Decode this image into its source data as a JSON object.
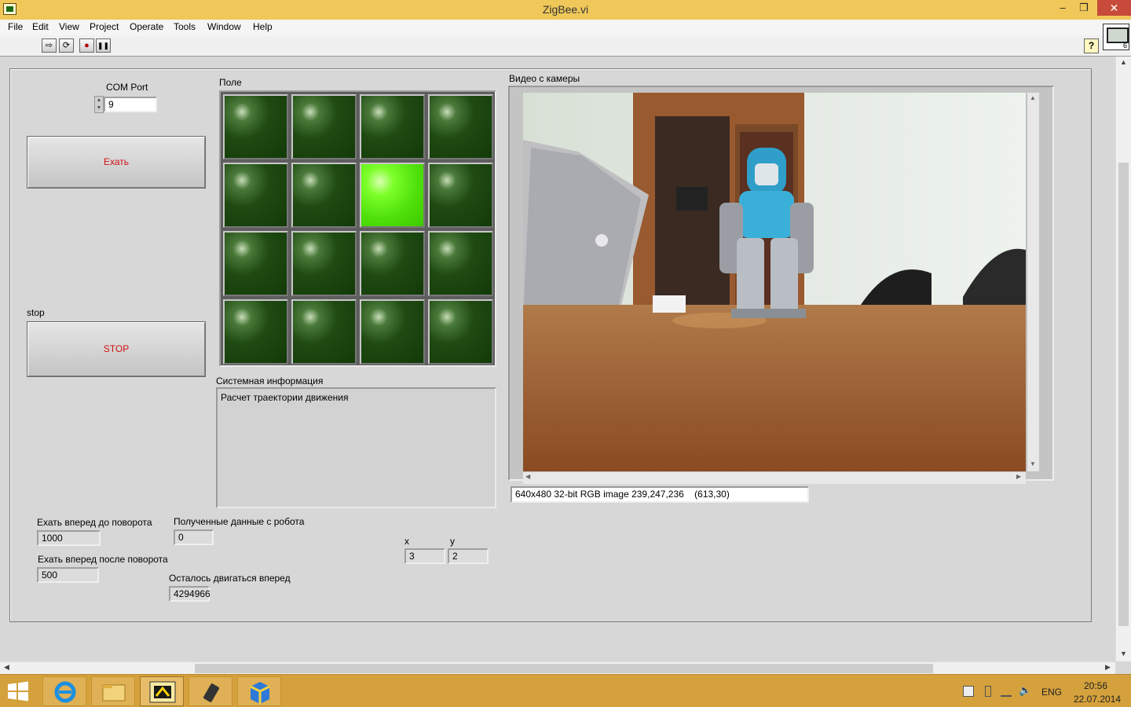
{
  "window": {
    "title": "ZigBee.vi",
    "controls": {
      "minimize": "–",
      "restore": "❐",
      "close": "✕"
    }
  },
  "menu": [
    "File",
    "Edit",
    "View",
    "Project",
    "Operate",
    "Tools",
    "Window",
    "Help"
  ],
  "toolbar": {
    "run": "⇨",
    "run_continuously": "⟳",
    "abort": "●",
    "pause": "❚❚",
    "help": "?"
  },
  "panel": {
    "com_port": {
      "label": "COM Port",
      "value": "9"
    },
    "go_button": {
      "label": "Ехать"
    },
    "stop_control": {
      "caption": "stop",
      "label": "STOP"
    },
    "field": {
      "label": "Поле",
      "rows": 4,
      "cols": 4,
      "lit": [
        [
          false,
          false,
          false,
          false
        ],
        [
          false,
          false,
          true,
          false
        ],
        [
          false,
          false,
          false,
          false
        ],
        [
          false,
          false,
          false,
          false
        ]
      ]
    },
    "system_info": {
      "label": "Системная информация",
      "text": "Расчет траектории движения"
    },
    "camera": {
      "label": "Видео с камеры",
      "image_info": "640x480 32-bit RGB image 239,247,236    (613,30)"
    },
    "forward_before_turn": {
      "label": "Ехать вперед до поворота",
      "value": "1000"
    },
    "forward_after_turn": {
      "label": "Ехать вперед после поворота",
      "value": "500"
    },
    "received_data": {
      "label": "Полученные данные с робота",
      "value": "0"
    },
    "remaining_forward": {
      "label": "Осталось двигаться вперед",
      "value": "4294966"
    },
    "x": {
      "label": "x",
      "value": "3"
    },
    "y": {
      "label": "y",
      "value": "2"
    }
  },
  "taskbar": {
    "apps": [
      "ie-icon",
      "file-explorer-icon",
      "labview-icon",
      "remote-icon",
      "package-icon"
    ],
    "tray": {
      "language": "ENG",
      "time": "20:56",
      "date": "22.07.2014"
    }
  },
  "colors": {
    "titlebar": "#f0c85a",
    "taskbar": "#d4a13c",
    "led_on": "#5cf010",
    "led_off": "#1f4a12",
    "button_text": "#d01010"
  }
}
